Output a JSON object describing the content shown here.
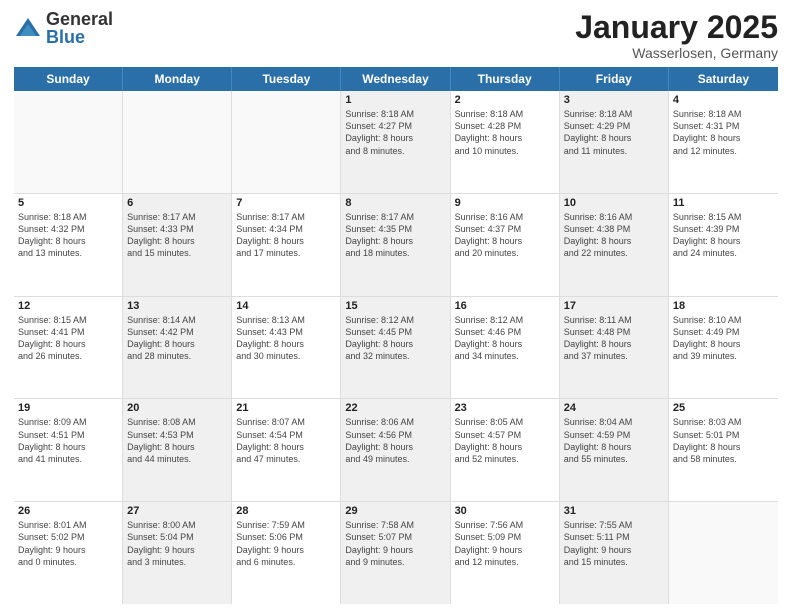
{
  "logo": {
    "general": "General",
    "blue": "Blue"
  },
  "title": "January 2025",
  "subtitle": "Wasserlosen, Germany",
  "weekdays": [
    "Sunday",
    "Monday",
    "Tuesday",
    "Wednesday",
    "Thursday",
    "Friday",
    "Saturday"
  ],
  "rows": [
    [
      {
        "day": "",
        "info": "",
        "empty": true
      },
      {
        "day": "",
        "info": "",
        "empty": true
      },
      {
        "day": "",
        "info": "",
        "empty": true
      },
      {
        "day": "1",
        "info": "Sunrise: 8:18 AM\nSunset: 4:27 PM\nDaylight: 8 hours\nand 8 minutes.",
        "shaded": true
      },
      {
        "day": "2",
        "info": "Sunrise: 8:18 AM\nSunset: 4:28 PM\nDaylight: 8 hours\nand 10 minutes."
      },
      {
        "day": "3",
        "info": "Sunrise: 8:18 AM\nSunset: 4:29 PM\nDaylight: 8 hours\nand 11 minutes.",
        "shaded": true
      },
      {
        "day": "4",
        "info": "Sunrise: 8:18 AM\nSunset: 4:31 PM\nDaylight: 8 hours\nand 12 minutes."
      }
    ],
    [
      {
        "day": "5",
        "info": "Sunrise: 8:18 AM\nSunset: 4:32 PM\nDaylight: 8 hours\nand 13 minutes."
      },
      {
        "day": "6",
        "info": "Sunrise: 8:17 AM\nSunset: 4:33 PM\nDaylight: 8 hours\nand 15 minutes.",
        "shaded": true
      },
      {
        "day": "7",
        "info": "Sunrise: 8:17 AM\nSunset: 4:34 PM\nDaylight: 8 hours\nand 17 minutes."
      },
      {
        "day": "8",
        "info": "Sunrise: 8:17 AM\nSunset: 4:35 PM\nDaylight: 8 hours\nand 18 minutes.",
        "shaded": true
      },
      {
        "day": "9",
        "info": "Sunrise: 8:16 AM\nSunset: 4:37 PM\nDaylight: 8 hours\nand 20 minutes."
      },
      {
        "day": "10",
        "info": "Sunrise: 8:16 AM\nSunset: 4:38 PM\nDaylight: 8 hours\nand 22 minutes.",
        "shaded": true
      },
      {
        "day": "11",
        "info": "Sunrise: 8:15 AM\nSunset: 4:39 PM\nDaylight: 8 hours\nand 24 minutes."
      }
    ],
    [
      {
        "day": "12",
        "info": "Sunrise: 8:15 AM\nSunset: 4:41 PM\nDaylight: 8 hours\nand 26 minutes."
      },
      {
        "day": "13",
        "info": "Sunrise: 8:14 AM\nSunset: 4:42 PM\nDaylight: 8 hours\nand 28 minutes.",
        "shaded": true
      },
      {
        "day": "14",
        "info": "Sunrise: 8:13 AM\nSunset: 4:43 PM\nDaylight: 8 hours\nand 30 minutes."
      },
      {
        "day": "15",
        "info": "Sunrise: 8:12 AM\nSunset: 4:45 PM\nDaylight: 8 hours\nand 32 minutes.",
        "shaded": true
      },
      {
        "day": "16",
        "info": "Sunrise: 8:12 AM\nSunset: 4:46 PM\nDaylight: 8 hours\nand 34 minutes."
      },
      {
        "day": "17",
        "info": "Sunrise: 8:11 AM\nSunset: 4:48 PM\nDaylight: 8 hours\nand 37 minutes.",
        "shaded": true
      },
      {
        "day": "18",
        "info": "Sunrise: 8:10 AM\nSunset: 4:49 PM\nDaylight: 8 hours\nand 39 minutes."
      }
    ],
    [
      {
        "day": "19",
        "info": "Sunrise: 8:09 AM\nSunset: 4:51 PM\nDaylight: 8 hours\nand 41 minutes."
      },
      {
        "day": "20",
        "info": "Sunrise: 8:08 AM\nSunset: 4:53 PM\nDaylight: 8 hours\nand 44 minutes.",
        "shaded": true
      },
      {
        "day": "21",
        "info": "Sunrise: 8:07 AM\nSunset: 4:54 PM\nDaylight: 8 hours\nand 47 minutes."
      },
      {
        "day": "22",
        "info": "Sunrise: 8:06 AM\nSunset: 4:56 PM\nDaylight: 8 hours\nand 49 minutes.",
        "shaded": true
      },
      {
        "day": "23",
        "info": "Sunrise: 8:05 AM\nSunset: 4:57 PM\nDaylight: 8 hours\nand 52 minutes."
      },
      {
        "day": "24",
        "info": "Sunrise: 8:04 AM\nSunset: 4:59 PM\nDaylight: 8 hours\nand 55 minutes.",
        "shaded": true
      },
      {
        "day": "25",
        "info": "Sunrise: 8:03 AM\nSunset: 5:01 PM\nDaylight: 8 hours\nand 58 minutes."
      }
    ],
    [
      {
        "day": "26",
        "info": "Sunrise: 8:01 AM\nSunset: 5:02 PM\nDaylight: 9 hours\nand 0 minutes."
      },
      {
        "day": "27",
        "info": "Sunrise: 8:00 AM\nSunset: 5:04 PM\nDaylight: 9 hours\nand 3 minutes.",
        "shaded": true
      },
      {
        "day": "28",
        "info": "Sunrise: 7:59 AM\nSunset: 5:06 PM\nDaylight: 9 hours\nand 6 minutes."
      },
      {
        "day": "29",
        "info": "Sunrise: 7:58 AM\nSunset: 5:07 PM\nDaylight: 9 hours\nand 9 minutes.",
        "shaded": true
      },
      {
        "day": "30",
        "info": "Sunrise: 7:56 AM\nSunset: 5:09 PM\nDaylight: 9 hours\nand 12 minutes."
      },
      {
        "day": "31",
        "info": "Sunrise: 7:55 AM\nSunset: 5:11 PM\nDaylight: 9 hours\nand 15 minutes.",
        "shaded": true
      },
      {
        "day": "",
        "info": "",
        "empty": true
      }
    ]
  ]
}
